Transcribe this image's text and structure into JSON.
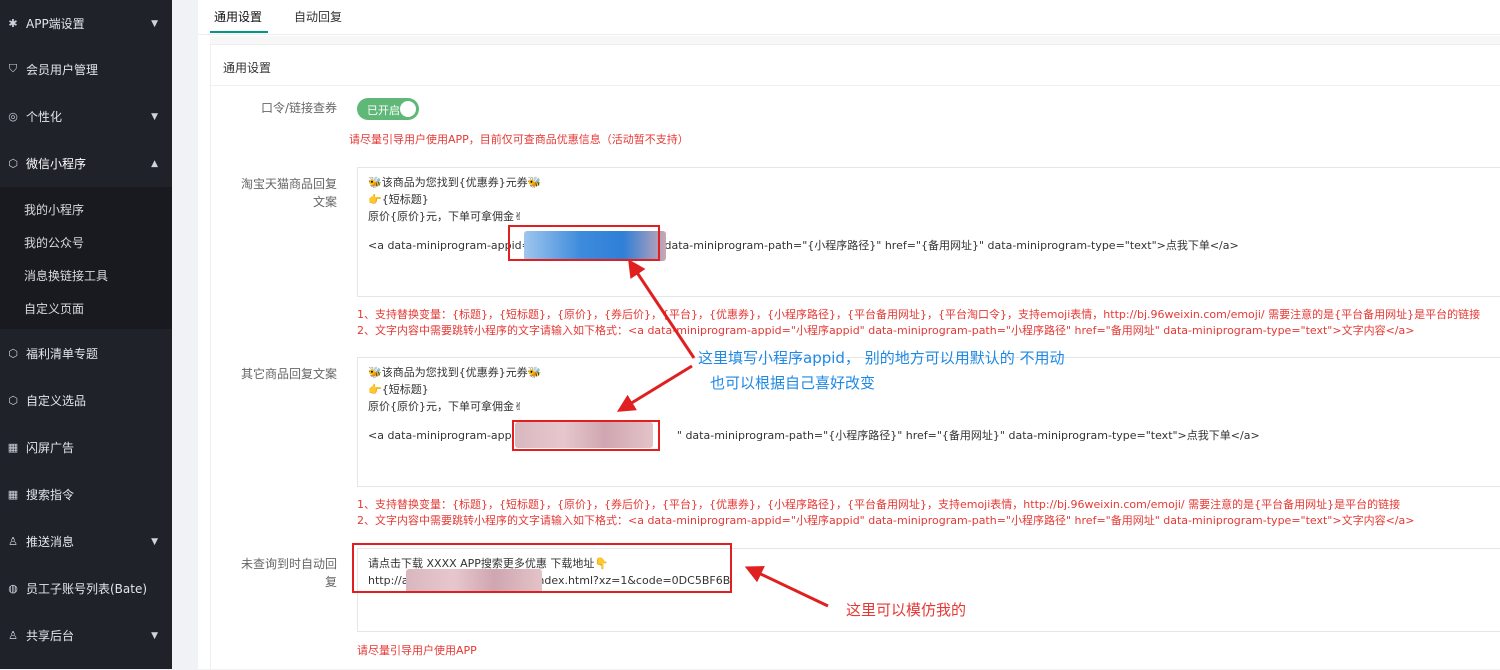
{
  "sidebar": {
    "items": [
      {
        "label": "APP端设置",
        "icon": "gear-icon"
      },
      {
        "label": "会员用户管理",
        "icon": "shield-icon"
      },
      {
        "label": "个性化",
        "icon": "palette-icon"
      },
      {
        "label": "微信小程序",
        "icon": "cube-icon"
      },
      {
        "label": "福利清单专题",
        "icon": "cube-icon"
      },
      {
        "label": "自定义选品",
        "icon": "cube-icon"
      },
      {
        "label": "闪屏广告",
        "icon": "grid-icon"
      },
      {
        "label": "搜索指令",
        "icon": "grid-icon"
      },
      {
        "label": "推送消息",
        "icon": "user-group-icon"
      },
      {
        "label": "员工子账号列表(Bate)",
        "icon": "globe-icon"
      },
      {
        "label": "共享后台",
        "icon": "user-group-icon"
      }
    ],
    "submenu": [
      "我的小程序",
      "我的公众号",
      "消息换链接工具",
      "自定义页面"
    ]
  },
  "tabs": [
    "通用设置",
    "自动回复"
  ],
  "panel": {
    "title": "通用设置",
    "fields": {
      "command_label": "口令/链接查券",
      "switch_text": "已开启",
      "command_hint": "请尽量引导用户使用APP，目前仅可查商品优惠信息（活动暂不支持）",
      "taobao_label_1": "淘宝天猫商品回复",
      "taobao_label_2": "文案",
      "other_label": "其它商品回复文案",
      "notfound_label_1": "未查询到时自动回",
      "notfound_label_2": "复"
    },
    "taobao_text": {
      "line1": "该商品为您找到{优惠券}元券",
      "line2": "{短标题}",
      "line3": "原价{原价}元，下单可拿佣金",
      "line4_pre": "<a data-miniprogram-appid=\"",
      "line4_post": "\" data-miniprogram-path=\"{小程序路径}\" href=\"{备用网址}\" data-miniprogram-type=\"text\">点我下单</a>"
    },
    "taobao_hint1": "1、支持替换变量：{标题}，{短标题}，{原价}，{券后价}，{平台}，{优惠券}，{小程序路径}，{平台备用网址}，{平台淘口令}，支持emoji表情，http://bj.96weixin.com/emoji/ 需要注意的是{平台备用网址}是平台的链接",
    "taobao_hint2": "2、文字内容中需要跳转小程序的文字请输入如下格式：<a data-miniprogram-appid=\"小程序appid\" data-miniprogram-path=\"小程序路径\" href=\"备用网址\" data-miniprogram-type=\"text\">文字内容</a>",
    "other_text": {
      "line1": "该商品为您找到{优惠券}元券",
      "line2": "{短标题}",
      "line3": "原价{原价}元，下单可拿佣金",
      "line4_pre": "<a data-miniprogram-appid=",
      "line4_post": "\" data-miniprogram-path=\"{小程序路径}\" href=\"{备用网址}\" data-miniprogram-type=\"text\">点我下单</a>"
    },
    "other_hint1": "1、支持替换变量：{标题}，{短标题}，{原价}，{券后价}，{平台}，{优惠券}，{小程序路径}，{平台备用网址}，支持emoji表情，http://bj.96weixin.com/emoji/ 需要注意的是{平台备用网址}是平台的链接",
    "other_hint2": "2、文字内容中需要跳转小程序的文字请输入如下格式：<a data-miniprogram-appid=\"小程序appid\" data-miniprogram-path=\"小程序路径\" href=\"备用网址\" data-miniprogram-type=\"text\">文字内容</a>",
    "notfound_text": {
      "line1": "请点击下载 XXXX APP搜索更多优惠 下载地址",
      "line2_pre": "http://ap",
      "line2_post": "ndex.html?xz=1&code=0DC5BF6B"
    },
    "notfound_hint": "请尽量引导用户使用APP"
  },
  "annotations": {
    "appid_note_1": "这里填写小程序appid， 别的地方可以用默认的 不用动",
    "appid_note_2": "也可以根据自己喜好改变",
    "imitate_note": "这里可以模仿我的"
  },
  "colors": {
    "sidebar_bg": "#20222a",
    "accent": "#009688",
    "switch_on": "#5fb878",
    "hint_red": "#e53935",
    "annotation_blue": "#1e88e5",
    "annotation_red": "#e02020"
  }
}
